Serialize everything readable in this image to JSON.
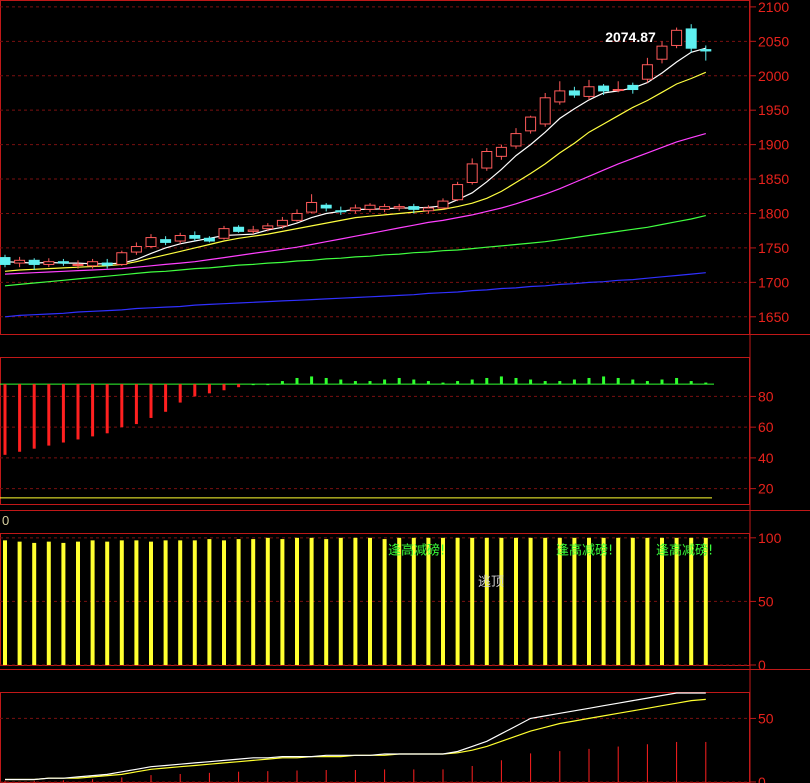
{
  "colors": {
    "background": "#000000",
    "frame": "#c01818",
    "axis_text": "#e8221c",
    "grid": "#7a1010",
    "candle_up": "#ff5a5a",
    "candle_down": "#5ef0f0",
    "ma5": "#ffffff",
    "ma10": "#ffff40",
    "ma20": "#ff40ff",
    "ma60": "#40ff40",
    "ma120": "#3030ff",
    "bar_pos": "#30ff30",
    "bar_neg": "#ff2020",
    "bar_yellow": "#ffff30",
    "signal_green": "#3aff3a"
  },
  "panel3": {
    "label": "0"
  },
  "chart_data": [
    {
      "type": "candlestick",
      "panel": "price",
      "ylim": [
        1625,
        2110
      ],
      "yticks": [
        "1650",
        "1700",
        "1750",
        "1800",
        "1850",
        "1900",
        "1950",
        "2000",
        "2050",
        "2100"
      ],
      "peak_label": "2074.87",
      "candles": [
        [
          1736,
          1726,
          1740,
          1722
        ],
        [
          1728,
          1732,
          1737,
          1722
        ],
        [
          1732,
          1726,
          1735,
          1718
        ],
        [
          1726,
          1730,
          1735,
          1722
        ],
        [
          1730,
          1728,
          1734,
          1724
        ],
        [
          1725,
          1726,
          1732,
          1720
        ],
        [
          1724,
          1730,
          1734,
          1720
        ],
        [
          1728,
          1725,
          1734,
          1720
        ],
        [
          1726,
          1743,
          1746,
          1724
        ],
        [
          1744,
          1752,
          1758,
          1740
        ],
        [
          1752,
          1765,
          1770,
          1750
        ],
        [
          1762,
          1758,
          1767,
          1754
        ],
        [
          1760,
          1768,
          1772,
          1756
        ],
        [
          1768,
          1764,
          1774,
          1760
        ],
        [
          1764,
          1760,
          1767,
          1758
        ],
        [
          1764,
          1778,
          1782,
          1762
        ],
        [
          1780,
          1774,
          1783,
          1772
        ],
        [
          1774,
          1776,
          1782,
          1770
        ],
        [
          1778,
          1782,
          1786,
          1774
        ],
        [
          1782,
          1790,
          1795,
          1778
        ],
        [
          1790,
          1800,
          1806,
          1788
        ],
        [
          1802,
          1816,
          1828,
          1800
        ],
        [
          1812,
          1808,
          1815,
          1803
        ],
        [
          1804,
          1803,
          1810,
          1798
        ],
        [
          1804,
          1808,
          1813,
          1800
        ],
        [
          1806,
          1812,
          1815,
          1802
        ],
        [
          1806,
          1810,
          1814,
          1802
        ],
        [
          1808,
          1810,
          1814,
          1804
        ],
        [
          1810,
          1806,
          1814,
          1800
        ],
        [
          1804,
          1808,
          1812,
          1800
        ],
        [
          1808,
          1818,
          1822,
          1806
        ],
        [
          1820,
          1842,
          1846,
          1818
        ],
        [
          1845,
          1872,
          1880,
          1842
        ],
        [
          1866,
          1890,
          1895,
          1862
        ],
        [
          1883,
          1896,
          1900,
          1878
        ],
        [
          1898,
          1916,
          1924,
          1894
        ],
        [
          1920,
          1940,
          1942,
          1916
        ],
        [
          1930,
          1968,
          1975,
          1926
        ],
        [
          1962,
          1978,
          1992,
          1958
        ],
        [
          1978,
          1972,
          1984,
          1968
        ],
        [
          1970,
          1984,
          1994,
          1965
        ],
        [
          1985,
          1978,
          1988,
          1972
        ],
        [
          1980,
          1980,
          1992,
          1976
        ],
        [
          1986,
          1980,
          1990,
          1974
        ],
        [
          1995,
          2016,
          2026,
          1990
        ],
        [
          2024,
          2043,
          2050,
          2018
        ],
        [
          2044,
          2066,
          2070,
          2040
        ],
        [
          2068,
          2040,
          2074.87,
          2034
        ],
        [
          2038,
          2036,
          2044,
          2022
        ]
      ],
      "series": [
        {
          "name": "MA5",
          "color": "#ffffff",
          "values": [
            1730,
            1729,
            1728,
            1729,
            1728,
            1728,
            1727,
            1727,
            1728,
            1733,
            1742,
            1750,
            1756,
            1760,
            1764,
            1768,
            1769,
            1770,
            1776,
            1780,
            1786,
            1794,
            1800,
            1803,
            1806,
            1806,
            1807,
            1808,
            1808,
            1809,
            1811,
            1820,
            1830,
            1846,
            1864,
            1884,
            1900,
            1918,
            1938,
            1952,
            1965,
            1975,
            1978,
            1982,
            1990,
            2004,
            2020,
            2034,
            2040
          ]
        },
        {
          "name": "MA10",
          "color": "#ffff40",
          "values": [
            1716,
            1718,
            1719,
            1720,
            1721,
            1722,
            1723,
            1724,
            1726,
            1730,
            1735,
            1740,
            1745,
            1750,
            1755,
            1760,
            1764,
            1767,
            1770,
            1774,
            1778,
            1782,
            1786,
            1790,
            1794,
            1796,
            1798,
            1800,
            1802,
            1804,
            1806,
            1810,
            1815,
            1822,
            1832,
            1845,
            1858,
            1872,
            1888,
            1902,
            1918,
            1930,
            1942,
            1954,
            1964,
            1976,
            1988,
            1996,
            2005
          ]
        },
        {
          "name": "MA20",
          "color": "#ff40ff",
          "values": [
            1712,
            1713,
            1714,
            1715,
            1716,
            1717,
            1718,
            1719,
            1720,
            1722,
            1724,
            1726,
            1728,
            1730,
            1733,
            1736,
            1739,
            1742,
            1745,
            1748,
            1751,
            1755,
            1759,
            1763,
            1767,
            1771,
            1775,
            1779,
            1783,
            1787,
            1790,
            1794,
            1798,
            1803,
            1808,
            1814,
            1821,
            1828,
            1836,
            1845,
            1854,
            1863,
            1872,
            1880,
            1888,
            1896,
            1904,
            1910,
            1916
          ]
        },
        {
          "name": "MA60",
          "color": "#40ff40",
          "values": [
            1695,
            1697,
            1699,
            1701,
            1703,
            1705,
            1707,
            1709,
            1711,
            1713,
            1715,
            1716,
            1718,
            1720,
            1721,
            1723,
            1725,
            1726,
            1728,
            1729,
            1731,
            1732,
            1734,
            1735,
            1737,
            1738,
            1740,
            1741,
            1743,
            1744,
            1746,
            1747,
            1749,
            1751,
            1753,
            1755,
            1757,
            1759,
            1762,
            1765,
            1768,
            1771,
            1774,
            1777,
            1780,
            1784,
            1788,
            1792,
            1797
          ]
        },
        {
          "name": "MA120",
          "color": "#3030ff",
          "values": [
            1650,
            1652,
            1653,
            1654,
            1655,
            1657,
            1658,
            1659,
            1660,
            1662,
            1663,
            1664,
            1665,
            1667,
            1668,
            1669,
            1670,
            1671,
            1672,
            1673,
            1674,
            1675,
            1676,
            1677,
            1678,
            1679,
            1680,
            1681,
            1682,
            1684,
            1685,
            1686,
            1688,
            1689,
            1691,
            1692,
            1694,
            1695,
            1697,
            1698,
            1700,
            1701,
            1703,
            1704,
            1706,
            1708,
            1710,
            1712,
            1714
          ]
        }
      ]
    },
    {
      "type": "bar",
      "panel": "oscillator",
      "ylim": [
        10,
        105
      ],
      "yticks": [
        "20",
        "40",
        "60",
        "80"
      ],
      "baseline": 88,
      "values": [
        42,
        44,
        46,
        48,
        50,
        52,
        54,
        56,
        60,
        62,
        66,
        70,
        76,
        80,
        82,
        84,
        86,
        88,
        88,
        90,
        92,
        93,
        92,
        91,
        90,
        90,
        91,
        92,
        91,
        90,
        89,
        90,
        91,
        92,
        93,
        92,
        91,
        90,
        90,
        91,
        92,
        93,
        92,
        91,
        90,
        91,
        92,
        90,
        89
      ]
    },
    {
      "type": "bar",
      "panel": "indicator",
      "ylim": [
        0,
        103
      ],
      "yticks": [
        "0",
        "50",
        "100"
      ],
      "values": [
        98,
        97,
        96,
        97,
        96,
        97,
        98,
        97,
        98,
        98,
        97,
        98,
        98,
        98,
        99,
        98,
        99,
        99,
        100,
        99,
        100,
        100,
        99,
        100,
        100,
        100,
        99,
        100,
        100,
        100,
        100,
        100,
        100,
        100,
        100,
        100,
        100,
        100,
        100,
        100,
        100,
        100,
        100,
        100,
        100,
        100,
        100,
        100,
        100
      ],
      "signals": [
        "逢高减磅!",
        "逢高减磅!",
        "逢高减磅!"
      ],
      "top_label": "逃顶"
    },
    {
      "type": "line",
      "panel": "lower",
      "ylim": [
        0,
        70
      ],
      "yticks": [
        "0",
        "50"
      ],
      "series": [
        {
          "name": "white",
          "values": [
            2,
            2,
            2,
            3,
            3,
            4,
            5,
            6,
            8,
            10,
            12,
            13,
            14,
            15,
            16,
            17,
            18,
            19,
            19,
            20,
            20,
            20,
            21,
            21,
            21,
            21,
            22,
            22,
            22,
            22,
            22,
            24,
            28,
            32,
            38,
            44,
            50,
            52,
            54,
            56,
            58,
            60,
            62,
            64,
            66,
            68,
            70,
            70,
            70
          ]
        },
        {
          "name": "yellow",
          "values": [
            2,
            2,
            2,
            3,
            3,
            3,
            4,
            5,
            6,
            8,
            10,
            11,
            12,
            13,
            14,
            15,
            16,
            17,
            18,
            19,
            19,
            20,
            20,
            20,
            21,
            21,
            21,
            22,
            22,
            22,
            22,
            23,
            25,
            28,
            32,
            36,
            40,
            43,
            46,
            48,
            50,
            52,
            54,
            56,
            58,
            60,
            62,
            64,
            65
          ]
        }
      ]
    }
  ]
}
